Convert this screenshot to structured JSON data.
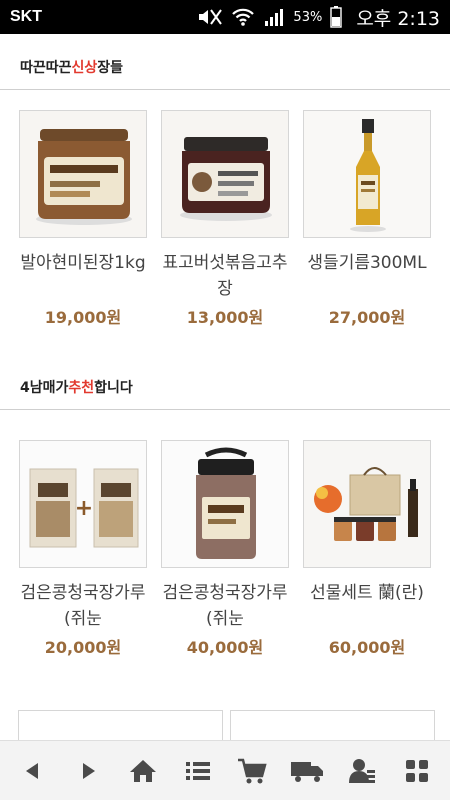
{
  "status_bar": {
    "carrier": "SKT",
    "battery": "53%",
    "time": "오후 2:13"
  },
  "sections": [
    {
      "title_pre": "따끈따끈 ",
      "title_highlight": "신상",
      "title_post": " 장들",
      "products": [
        {
          "name": "발아현미된장1kg",
          "price": "19,000원",
          "image": "jar-doenjang"
        },
        {
          "name": "표고버섯볶음고추장",
          "price": "13,000원",
          "image": "jar-gochujang"
        },
        {
          "name": "생들기름300ML",
          "price": "27,000원",
          "image": "oil-bottle"
        }
      ]
    },
    {
      "title_pre": "4남매가 ",
      "title_highlight": "추천",
      "title_post": "합니다",
      "products": [
        {
          "name": "검은콩청국장가루(쥐눈",
          "price": "20,000원",
          "image": "powder-bags"
        },
        {
          "name": "검은콩청국장가루(쥐눈",
          "price": "40,000원",
          "image": "powder-jar"
        },
        {
          "name": "선물세트 蘭(란)",
          "price": "60,000원",
          "image": "gift-set"
        }
      ]
    }
  ],
  "colors": {
    "highlight": "#e23a2f",
    "price": "#9a6b3c",
    "nav_icon": "#4a4a4a"
  },
  "bottom_nav": [
    {
      "icon": "back-arrow-icon"
    },
    {
      "icon": "forward-arrow-icon"
    },
    {
      "icon": "home-icon"
    },
    {
      "icon": "list-menu-icon"
    },
    {
      "icon": "cart-icon"
    },
    {
      "icon": "delivery-truck-icon"
    },
    {
      "icon": "user-account-icon"
    },
    {
      "icon": "grid-menu-icon"
    }
  ]
}
